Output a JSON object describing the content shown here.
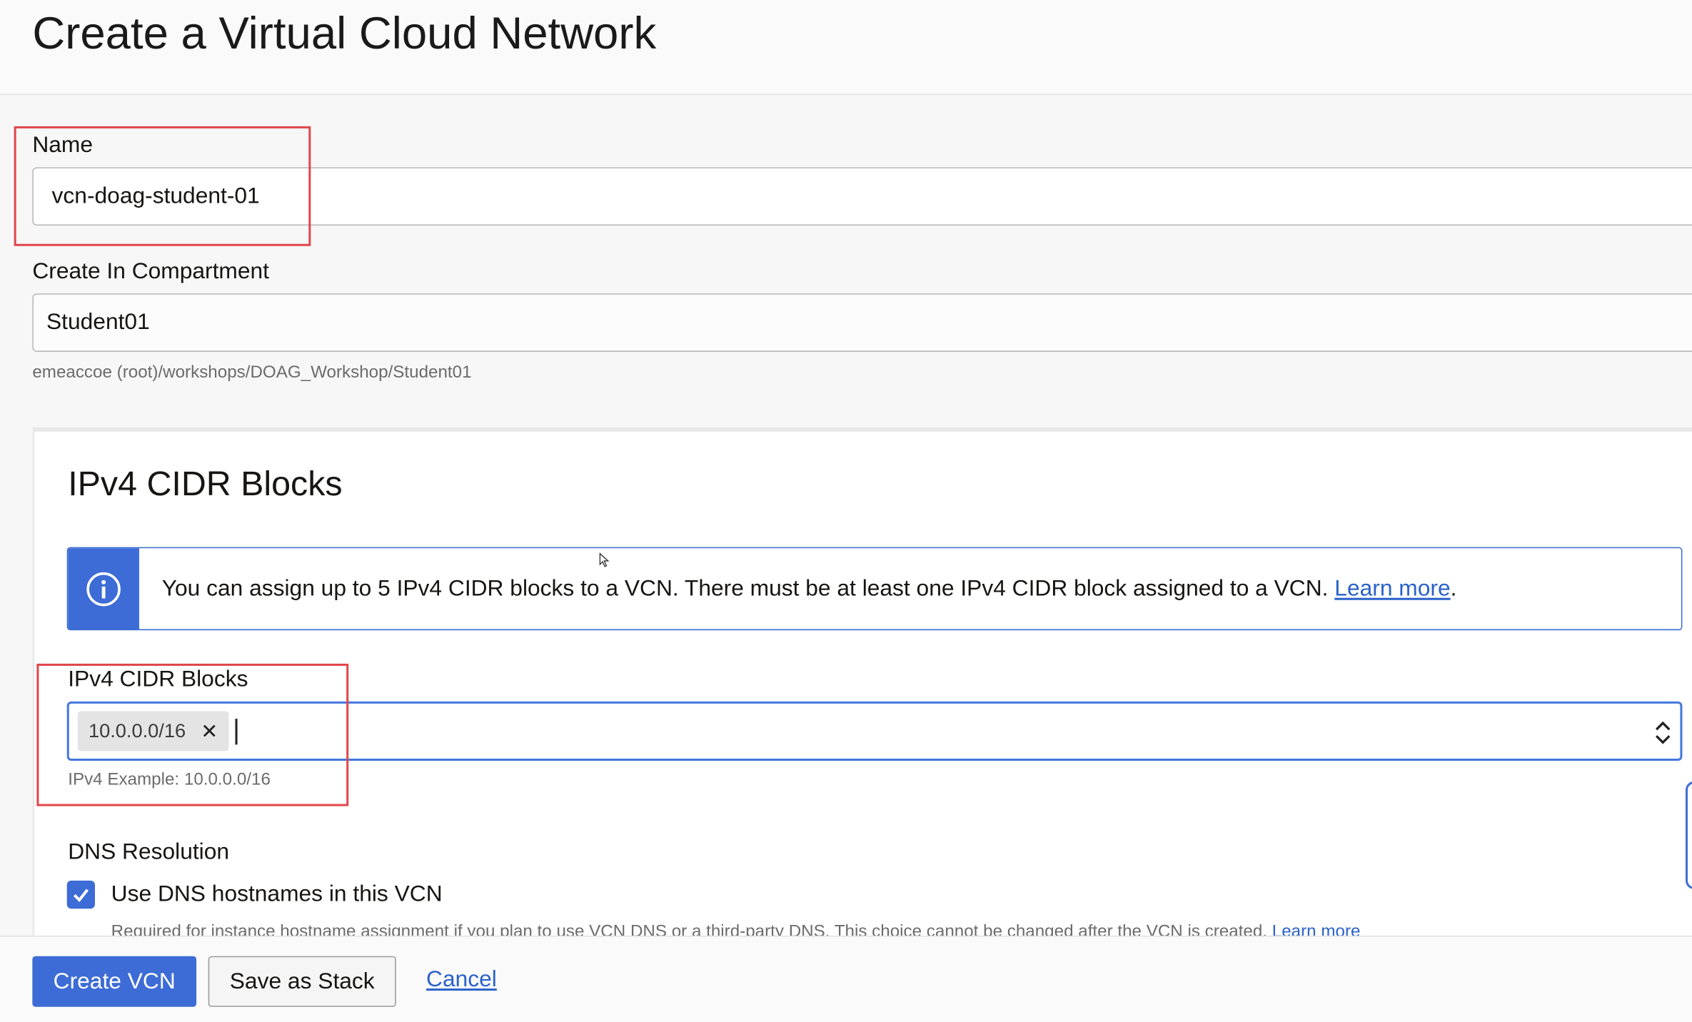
{
  "page": {
    "title": "Create a Virtual Cloud Network"
  },
  "name_field": {
    "label": "Name",
    "value": "vcn-doag-student-01"
  },
  "compartment": {
    "label": "Create In Compartment",
    "value": "Student01",
    "path": "emeaccoe (root)/workshops/DOAG_Workshop/Student01"
  },
  "cidr_section": {
    "title": "IPv4 CIDR Blocks",
    "info": {
      "text": "You can assign up to 5 IPv4 CIDR blocks to a VCN. There must be at least one IPv4 CIDR block assigned to a VCN. ",
      "link": "Learn more",
      "suffix": "."
    },
    "field_label": "IPv4 CIDR Blocks",
    "chips": [
      "10.0.0.0/16"
    ],
    "example": "IPv4 Example: 10.0.0.0/16"
  },
  "dns": {
    "label": "DNS Resolution",
    "checkbox_label": "Use DNS hostnames in this VCN",
    "checked": true,
    "help_text": "Required for instance hostname assignment if you plan to use VCN DNS or a third-party DNS. This choice cannot be changed after the VCN is created.",
    "help_link": "Learn more"
  },
  "footer": {
    "create_label": "Create VCN",
    "stack_label": "Save as Stack",
    "cancel_label": "Cancel"
  },
  "colors": {
    "accent": "#3d6cd6",
    "highlight_box": "#e0474c",
    "link": "#2a62c9"
  },
  "icons": {
    "info": "info-circle-icon",
    "remove_chip": "close-icon",
    "select_arrows": "chevron-up-down-icon",
    "checkbox": "checkmark-icon"
  }
}
